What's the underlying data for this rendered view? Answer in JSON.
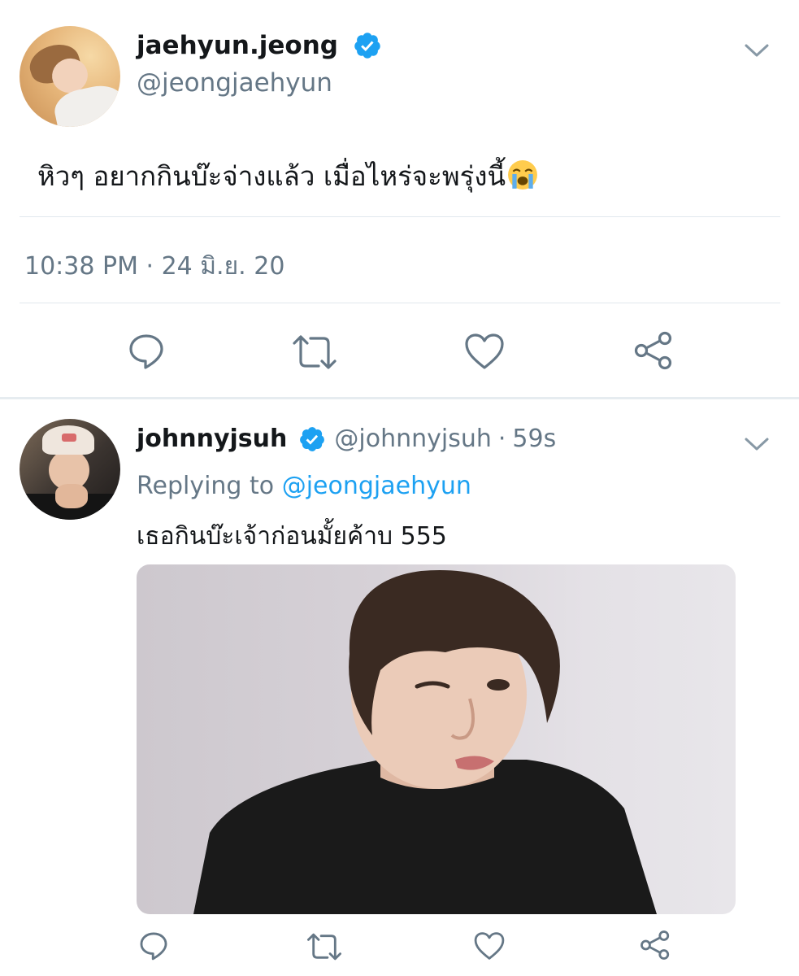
{
  "main_tweet": {
    "display_name": "jaehyun.jeong",
    "handle": "@jeongjaehyun",
    "text": "หิวๆ อยากกินบ๊ะจ่างแล้ว เมื่อไหร่จะพรุ่งนี้",
    "emoji": "crying-face",
    "timestamp": "10:38 PM · 24 มิ.ย. 20",
    "verified": true,
    "icons": [
      "reply-icon",
      "retweet-icon",
      "like-icon",
      "share-icon",
      "chevron-down-icon",
      "verified-badge-icon"
    ]
  },
  "reply_tweet": {
    "display_name": "johnnyjsuh",
    "handle": "@johnnyjsuh",
    "separator": "·",
    "time_ago": "59s",
    "replying_prefix": "Replying to",
    "replying_mention": "@jeongjaehyun",
    "text": "เธอกินบ๊ะเจ้าก่อนมั้ยค้าบ  555",
    "verified": true,
    "has_media": true
  },
  "colors": {
    "text_primary": "#14171a",
    "text_secondary": "#657786",
    "accent": "#1da1f2",
    "divider": "#e1e8ed"
  }
}
